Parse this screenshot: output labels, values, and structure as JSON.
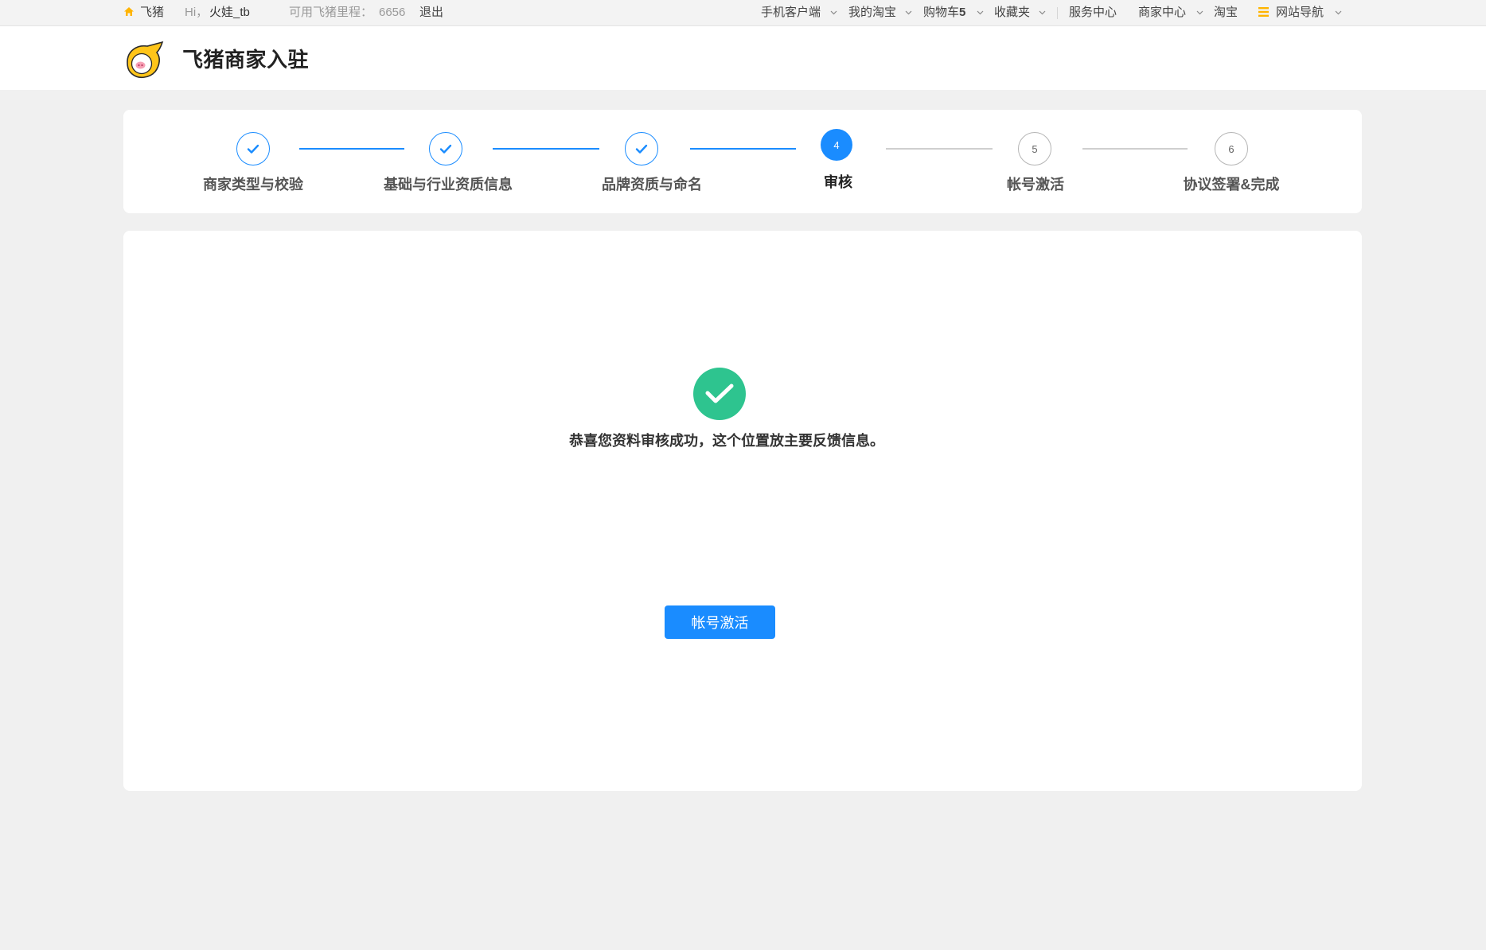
{
  "colors": {
    "accent": "#1a8cff",
    "success": "#2ec48f",
    "brand": "#ffb400",
    "page_bg": "#f0f0f0",
    "pending": "#b5b5b5"
  },
  "topbar": {
    "home": {
      "icon": "home-icon",
      "label": "飞猪"
    },
    "greeting": "Hi，",
    "username": "火娃_tb",
    "mileage_label": "可用飞猪里程：",
    "mileage_value": "6656",
    "logout": "退出",
    "nav": [
      {
        "label": "手机客户端",
        "icon": "chevron-down-icon"
      },
      {
        "label": "我的淘宝",
        "icon": "chevron-down-icon"
      },
      {
        "label": "购物车",
        "count": "5",
        "icon": "chevron-down-icon"
      },
      {
        "label": "收藏夹",
        "icon": "chevron-down-icon"
      },
      {
        "label": "服务中心"
      },
      {
        "label": "商家中心",
        "icon": "chevron-down-icon"
      },
      {
        "label": "淘宝"
      },
      {
        "label": "网站导航",
        "leading_icon": "menu-icon",
        "icon": "chevron-down-icon"
      }
    ]
  },
  "header": {
    "logo_icon": "fliggy-logo-icon",
    "title": "飞猪商家入驻"
  },
  "steps": {
    "current": 4,
    "items": [
      {
        "label": "商家类型与校验",
        "icon": "check-icon"
      },
      {
        "label": "基础与行业资质信息",
        "icon": "check-icon"
      },
      {
        "label": "品牌资质与命名",
        "icon": "check-icon"
      },
      {
        "number": "4",
        "label": "审核",
        "active": true
      },
      {
        "number": "5",
        "label": "帐号激活"
      },
      {
        "number": "6",
        "label": "协议签署&完成"
      }
    ]
  },
  "result": {
    "icon": "success-check-icon",
    "message": "恭喜您资料审核成功，这个位置放主要反馈信息。",
    "button_label": "帐号激活"
  }
}
